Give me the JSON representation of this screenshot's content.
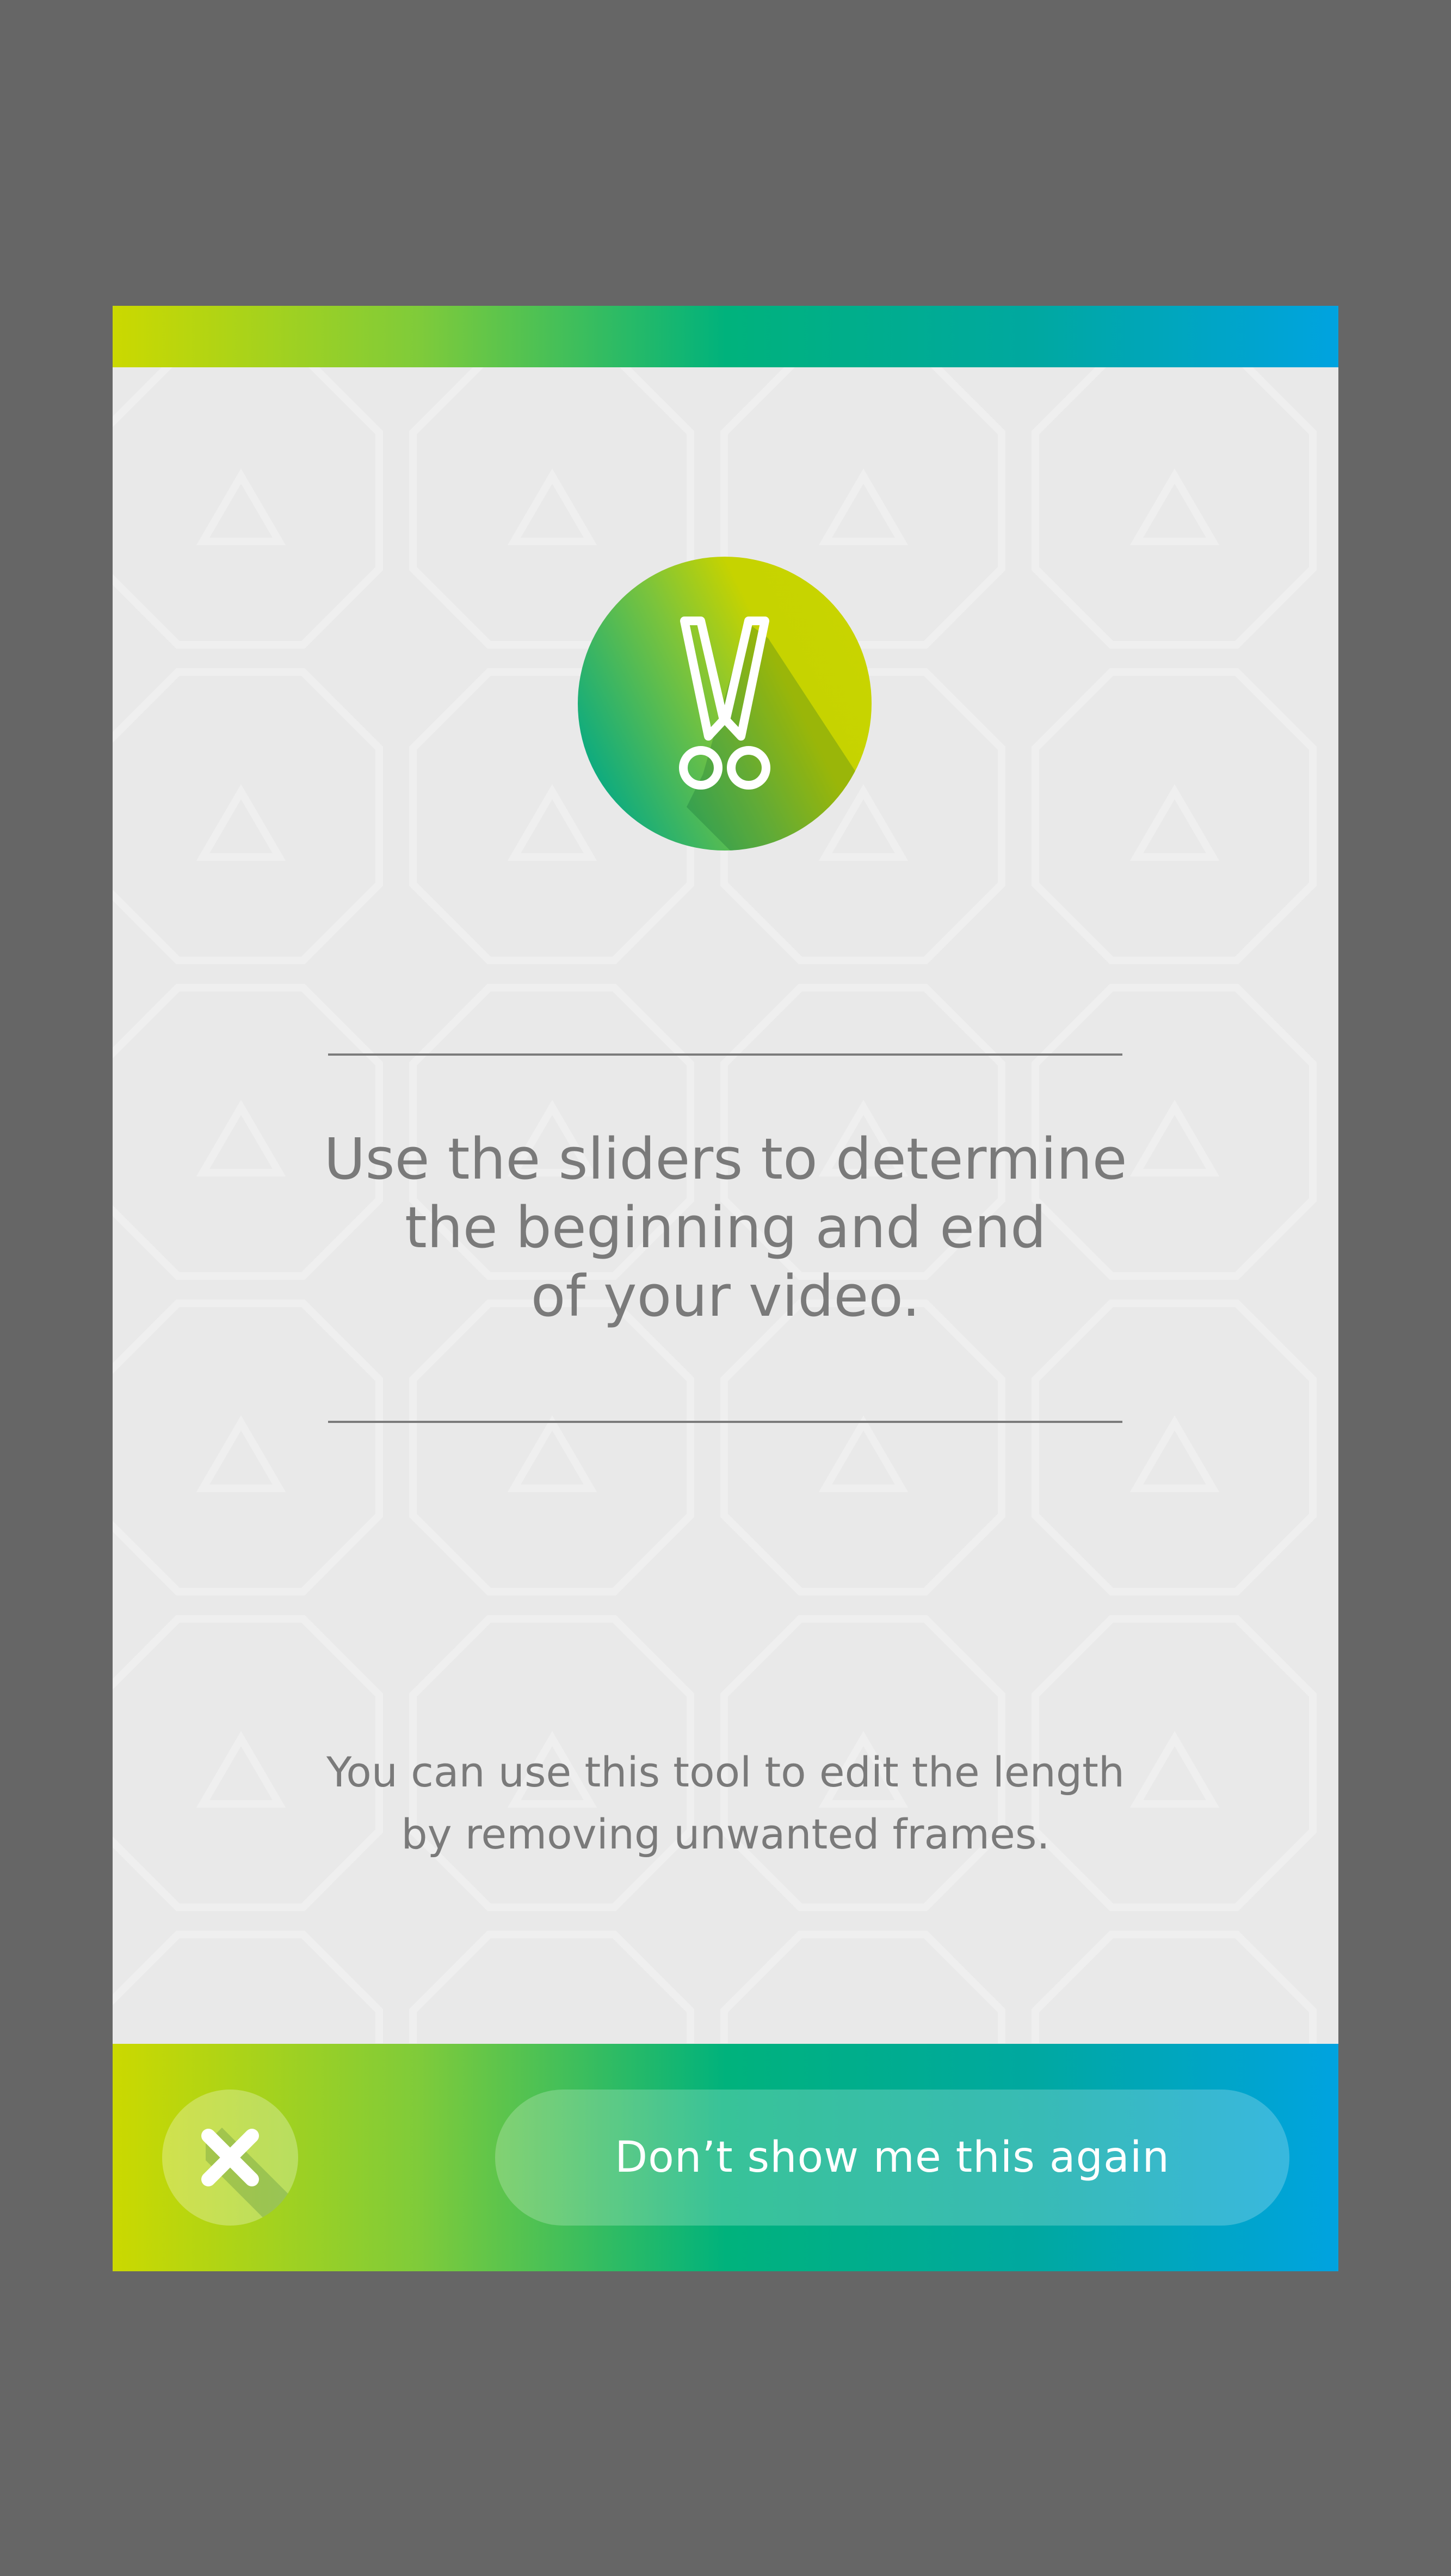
{
  "dialog": {
    "headline": "Use the sliders to determine\nthe beginning and end\nof your video.",
    "subtext": "You can use this tool to edit the length\nby removing unwanted frames.",
    "icon": "scissors-icon",
    "close_icon": "close-icon",
    "dont_show_label": "Don’t show me this again"
  },
  "colors": {
    "background": "#666666",
    "card": "#e9e9e9",
    "text": "#7a7a7a",
    "gradient": [
      "#cbd900",
      "#7fcb3a",
      "#00b27c",
      "#00a8a0",
      "#00a3e0"
    ]
  }
}
